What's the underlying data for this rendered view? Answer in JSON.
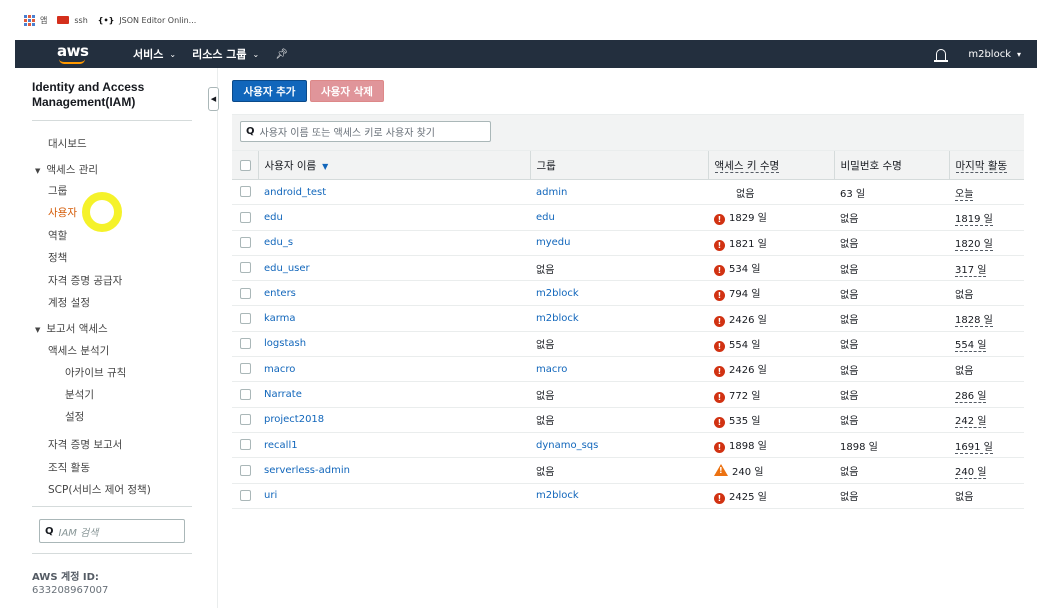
{
  "bookmarks": [
    {
      "label": "앱",
      "icon": "apps-grid-icon"
    },
    {
      "label": "ssh",
      "icon": "ssh-bookmark-icon"
    },
    {
      "label": "JSON Editor Onlin...",
      "icon": "json-bookmark-icon"
    }
  ],
  "topnav": {
    "logo": "aws",
    "services": "서비스",
    "resource_groups": "리소스 그룹",
    "pin_icon": "pin-icon",
    "bell_icon": "bell-icon",
    "account": "m2block"
  },
  "sidebar": {
    "title": "Identity and Access Management(IAM)",
    "dashboard": "대시보드",
    "access_mgmt": "액세스 관리",
    "items": [
      "그룹",
      "사용자",
      "역할",
      "정책",
      "자격 증명 공급자",
      "계정 설정"
    ],
    "active_item": "사용자",
    "reports": "보고서 액세스",
    "access_analyzer": "액세스 분석기",
    "analyzer_sub": [
      "아카이브 규칙",
      "분석기",
      "설정"
    ],
    "more": [
      "자격 증명 보고서",
      "조직 활동",
      "SCP(서비스 제어 정책)"
    ],
    "search_placeholder": "IAM 검색",
    "account_label": "AWS 계정 ID:",
    "account_id": "633208967007"
  },
  "main": {
    "add_user": "사용자 추가",
    "delete_user": "사용자 삭제",
    "search_placeholder": "사용자 이름 또는 액세스 키로 사용자 찾기",
    "columns": [
      "사용자 이름",
      "그룹",
      "액세스 키 수명",
      "비밀번호 수명",
      "마지막 활동"
    ],
    "rows": [
      {
        "user": "android_test",
        "group": "admin",
        "key_age": "없음",
        "key_warn": "none",
        "pw_age": "63 일",
        "last": "오늘"
      },
      {
        "user": "edu",
        "group": "edu",
        "key_age": "1829 일",
        "key_warn": "red",
        "pw_age": "없음",
        "last": "1819 일"
      },
      {
        "user": "edu_s",
        "group": "myedu",
        "key_age": "1821 일",
        "key_warn": "red",
        "pw_age": "없음",
        "last": "1820 일"
      },
      {
        "user": "edu_user",
        "group": "없음",
        "key_age": "534 일",
        "key_warn": "red",
        "pw_age": "없음",
        "last": "317 일"
      },
      {
        "user": "enters",
        "group": "m2block",
        "key_age": "794 일",
        "key_warn": "red",
        "pw_age": "없음",
        "last": "없음"
      },
      {
        "user": "karma",
        "group": "m2block",
        "key_age": "2426 일",
        "key_warn": "red",
        "pw_age": "없음",
        "last": "1828 일"
      },
      {
        "user": "logstash",
        "group": "없음",
        "key_age": "554 일",
        "key_warn": "red",
        "pw_age": "없음",
        "last": "554 일"
      },
      {
        "user": "macro",
        "group": "macro",
        "key_age": "2426 일",
        "key_warn": "red",
        "pw_age": "없음",
        "last": "없음"
      },
      {
        "user": "Narrate",
        "group": "없음",
        "key_age": "772 일",
        "key_warn": "red",
        "pw_age": "없음",
        "last": "286 일"
      },
      {
        "user": "project2018",
        "group": "없음",
        "key_age": "535 일",
        "key_warn": "red",
        "pw_age": "없음",
        "last": "242 일"
      },
      {
        "user": "recall1",
        "group": "dynamo_sqs",
        "key_age": "1898 일",
        "key_warn": "red",
        "pw_age": "1898 일",
        "last": "1691 일"
      },
      {
        "user": "serverless-admin",
        "group": "없음",
        "key_age": "240 일",
        "key_warn": "orange",
        "pw_age": "없음",
        "last": "240 일"
      },
      {
        "user": "uri",
        "group": "m2block",
        "key_age": "2425 일",
        "key_warn": "red",
        "pw_age": "없음",
        "last": "없음"
      }
    ]
  },
  "colors": {
    "nav_bg": "#232f3e",
    "primary": "#1166bb",
    "danger_disabled": "#e0959a",
    "warn_red": "#d13212",
    "warn_orange": "#ec7211",
    "active_link": "#d45b07",
    "highlight": "#f5f22a"
  }
}
